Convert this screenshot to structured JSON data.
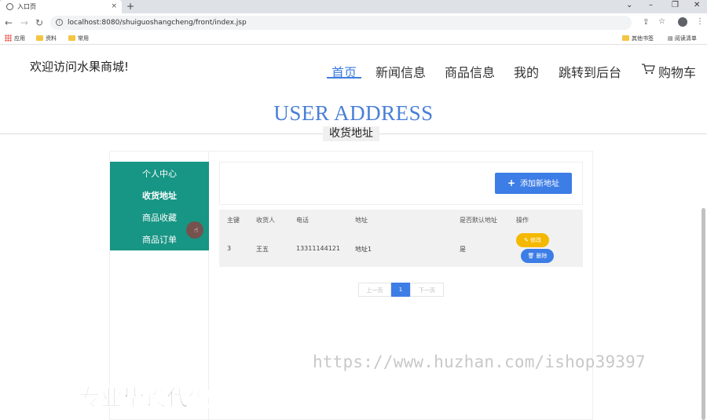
{
  "browser": {
    "tab_title": "入口页",
    "tab_close": "×",
    "new_tab": "+",
    "url": "localhost:8080/shuiguoshangcheng/front/index.jsp",
    "bookmarks": [
      "应用",
      "资料",
      "常用"
    ],
    "bookmarks_right": [
      "其他书签",
      "阅读清单"
    ]
  },
  "site": {
    "welcome": "欢迎访问水果商城!",
    "nav": [
      "首页",
      "新闻信息",
      "商品信息",
      "我的",
      "跳转到后台",
      "购物车"
    ],
    "active_nav": "首页"
  },
  "hero": {
    "title": "USER ADDRESS",
    "subtitle": "收货地址"
  },
  "side_menu": {
    "items": [
      "个人中心",
      "收货地址",
      "商品收藏",
      "商品订单"
    ],
    "active": "收货地址"
  },
  "toolbar": {
    "add_label": "添加新地址"
  },
  "table": {
    "headers": [
      "主键",
      "收货人",
      "电话",
      "地址",
      "是否默认地址",
      "操作"
    ],
    "rows": [
      {
        "id": "3",
        "name": "王五",
        "phone": "13311144121",
        "address": "地址1",
        "is_default": "是"
      }
    ],
    "edit_label": "修改",
    "delete_label": "删除"
  },
  "pagination": {
    "prev": "上一页",
    "current": "1",
    "next": "下一页"
  },
  "watermark": {
    "url": "https://www.huzhan.com/ishop39397",
    "text": "专业毕设代做"
  },
  "colors": {
    "accent": "#3d7de6",
    "menu_bg": "#179585",
    "edit": "#f5b800",
    "hero": "#4a7fd6"
  }
}
